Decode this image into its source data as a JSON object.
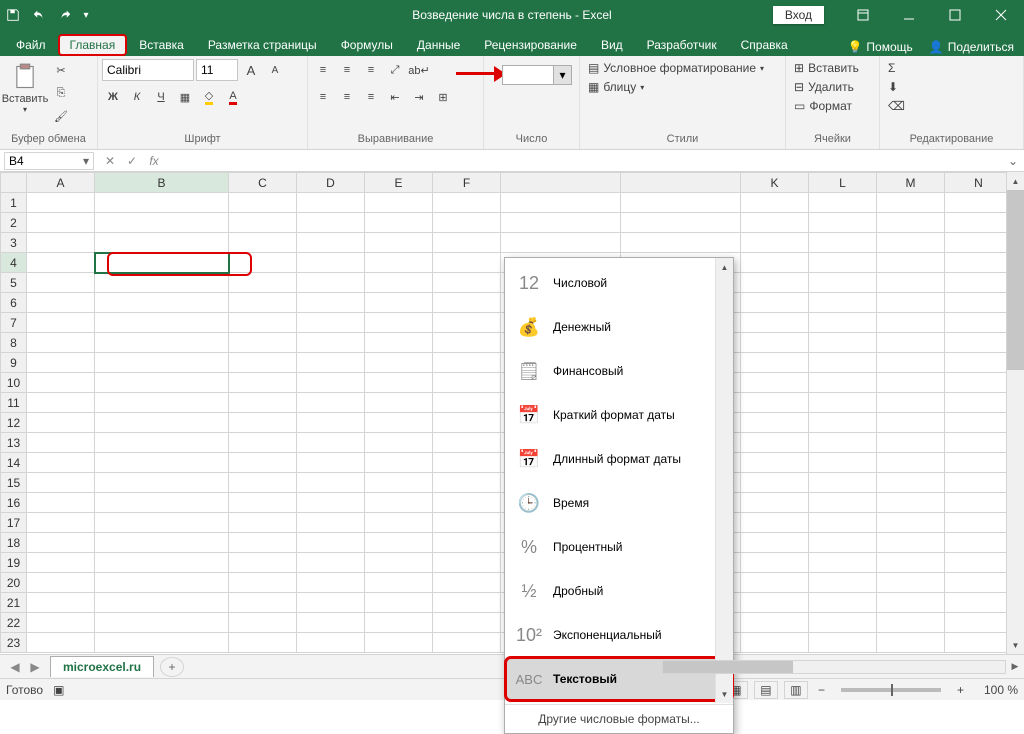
{
  "title": "Возведение числа в степень  -  Excel",
  "login": "Вход",
  "tabs": {
    "file": "Файл",
    "home": "Главная",
    "insert": "Вставка",
    "layout": "Разметка страницы",
    "formulas": "Формулы",
    "data": "Данные",
    "review": "Рецензирование",
    "view": "Вид",
    "developer": "Разработчик",
    "help": "Справка",
    "helpbtn": "Помощь",
    "share": "Поделиться"
  },
  "ribbon": {
    "paste": "Вставить",
    "clipboard": "Буфер обмена",
    "font_name": "Calibri",
    "font_size": "11",
    "bold": "Ж",
    "italic": "К",
    "underline": "Ч",
    "font": "Шрифт",
    "alignment": "Выравнивание",
    "number": "Число",
    "cond_fmt": "Условное форматирование",
    "table_fmt": "блицу",
    "styles": "Стили",
    "insert_cells": "Вставить",
    "delete_cells": "Удалить",
    "format_cells": "Формат",
    "cells": "Ячейки",
    "editing": "Редактирование"
  },
  "namebox": "B4",
  "fmt_menu": {
    "preview_number": "12",
    "number": "Числовой",
    "currency": "Денежный",
    "accounting": "Финансовый",
    "short_date": "Краткий формат даты",
    "long_date": "Длинный формат даты",
    "time": "Время",
    "percent": "Процентный",
    "fraction": "Дробный",
    "scientific": "Экспоненциальный",
    "text": "Текстовый",
    "other": "Другие числовые форматы..."
  },
  "columns": [
    "A",
    "B",
    "C",
    "D",
    "E",
    "F",
    "",
    "",
    "K",
    "L",
    "M",
    "N"
  ],
  "rows": [
    "1",
    "2",
    "3",
    "4",
    "5",
    "6",
    "7",
    "8",
    "9",
    "10",
    "11",
    "12",
    "13",
    "14",
    "15",
    "16",
    "17",
    "18",
    "19",
    "20",
    "21",
    "22",
    "23"
  ],
  "sheet_tab": "microexcel.ru",
  "status": {
    "ready": "Готово",
    "zoom": "100 %"
  }
}
